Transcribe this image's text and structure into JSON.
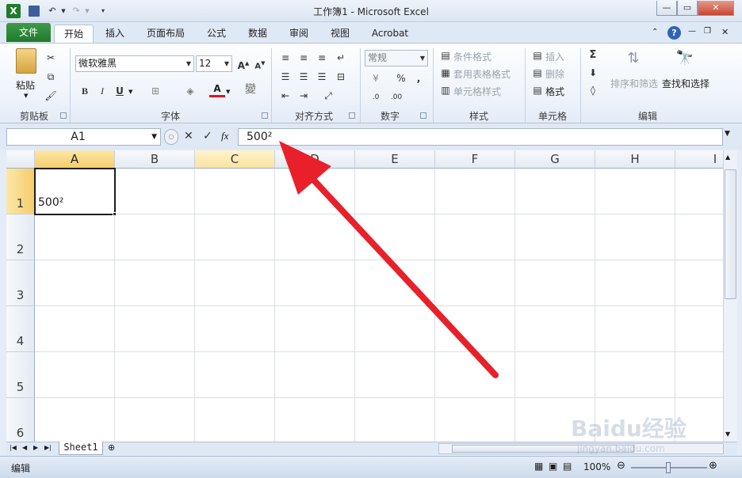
{
  "window": {
    "title": "工作簿1 - Microsoft Excel"
  },
  "tabs": [
    "文件",
    "开始",
    "插入",
    "页面布局",
    "公式",
    "数据",
    "审阅",
    "视图",
    "Acrobat"
  ],
  "ribbon": {
    "clipboard": {
      "paste": "粘贴",
      "label": "剪贴板"
    },
    "font": {
      "name": "微软雅黑",
      "size": "12",
      "label": "字体",
      "bold": "B",
      "italic": "I",
      "underline": "U",
      "font_color_glyph": "A",
      "phonetic": "wén"
    },
    "alignment": {
      "label": "对齐方式"
    },
    "number": {
      "format": "常规",
      "label": "数字",
      "percent": "%",
      "comma": ",",
      "inc_decimal": "←.0\n.00",
      "dec_decimal": ".00\n→.0"
    },
    "styles": {
      "conditional": "条件格式",
      "table": "套用表格格式",
      "cell": "单元格样式",
      "label": "样式"
    },
    "cells": {
      "insert": "插入",
      "delete": "删除",
      "format": "格式",
      "label": "单元格"
    },
    "editing": {
      "sum": "Σ",
      "sort": "排序和筛选",
      "find": "查找和选择",
      "label": "编辑"
    }
  },
  "formula_bar": {
    "name_box": "A1",
    "fx": "fx",
    "content": "500²"
  },
  "columns": [
    "A",
    "B",
    "C",
    "D",
    "E",
    "F",
    "G",
    "H",
    "I"
  ],
  "rows": [
    "1",
    "2",
    "3",
    "4",
    "5",
    "6"
  ],
  "cells": {
    "A1": "500²"
  },
  "sheet_tabs": [
    "Sheet1"
  ],
  "status": {
    "mode": "编辑",
    "zoom": "100%"
  },
  "colors": {
    "accent_arrow": "#e8202a",
    "file_tab": "#2a8436",
    "selection": "#f6cd6a"
  },
  "watermark": {
    "text": "Baidu经验",
    "url": "jingyan.baidu.com"
  }
}
